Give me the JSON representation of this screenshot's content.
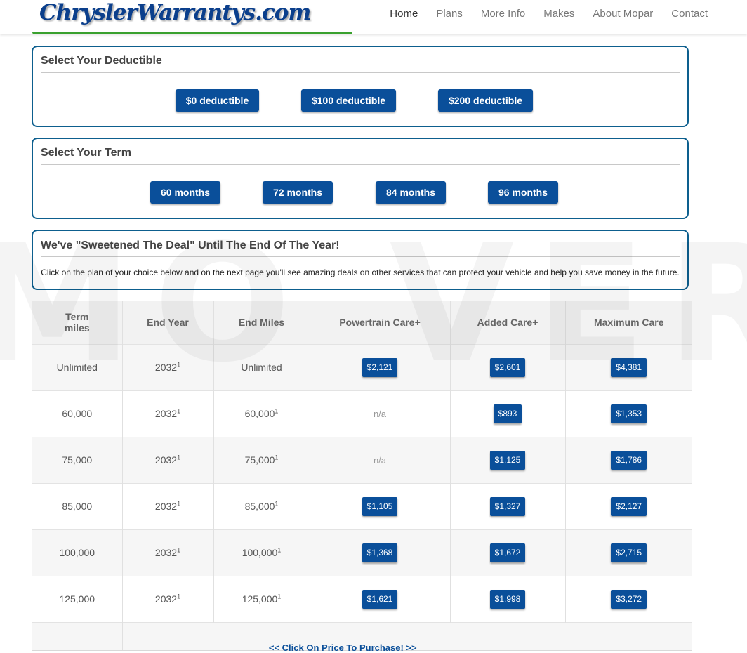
{
  "header": {
    "logo": "ChryslerWarrantys.com",
    "nav": [
      "Home",
      "Plans",
      "More Info",
      "Makes",
      "About Mopar",
      "Contact"
    ]
  },
  "watermark": "MO VERSI",
  "deductible": {
    "title": "Select Your Deductible",
    "options": [
      "$0 deductible",
      "$100 deductible",
      "$200 deductible"
    ]
  },
  "term": {
    "title": "Select Your Term",
    "options": [
      "60 months",
      "72 months",
      "84 months",
      "96 months"
    ]
  },
  "deal": {
    "title": "We've \"Sweetened The Deal\" Until The End Of The Year!",
    "text": "Click on the plan of your choice below and on the next page you'll see amazing deals on other services that can protect your vehicle and help you save money in the future."
  },
  "table": {
    "headers": {
      "term_line1": "Term",
      "term_line2": "miles",
      "end_year": "End Year",
      "end_miles": "End Miles",
      "powertrain": "Powertrain Care+",
      "added": "Added Care+",
      "maximum": "Maximum Care"
    },
    "footnote_mark": "1",
    "rows": [
      {
        "term": "Unlimited",
        "end_year": "2032",
        "end_miles": "Unlimited",
        "powertrain": "$2,121",
        "added": "$2,601",
        "maximum": "$4,381"
      },
      {
        "term": "60,000",
        "end_year": "2032",
        "end_miles": "60,000",
        "powertrain": "n/a",
        "added": "$893",
        "maximum": "$1,353"
      },
      {
        "term": "75,000",
        "end_year": "2032",
        "end_miles": "75,000",
        "powertrain": "n/a",
        "added": "$1,125",
        "maximum": "$1,786"
      },
      {
        "term": "85,000",
        "end_year": "2032",
        "end_miles": "85,000",
        "powertrain": "$1,105",
        "added": "$1,327",
        "maximum": "$2,127"
      },
      {
        "term": "100,000",
        "end_year": "2032",
        "end_miles": "100,000",
        "powertrain": "$1,368",
        "added": "$1,672",
        "maximum": "$2,715"
      },
      {
        "term": "125,000",
        "end_year": "2032",
        "end_miles": "125,000",
        "powertrain": "$1,621",
        "added": "$1,998",
        "maximum": "$3,272"
      }
    ],
    "footer_link": "<< Click On Price To Purchase! >>"
  }
}
